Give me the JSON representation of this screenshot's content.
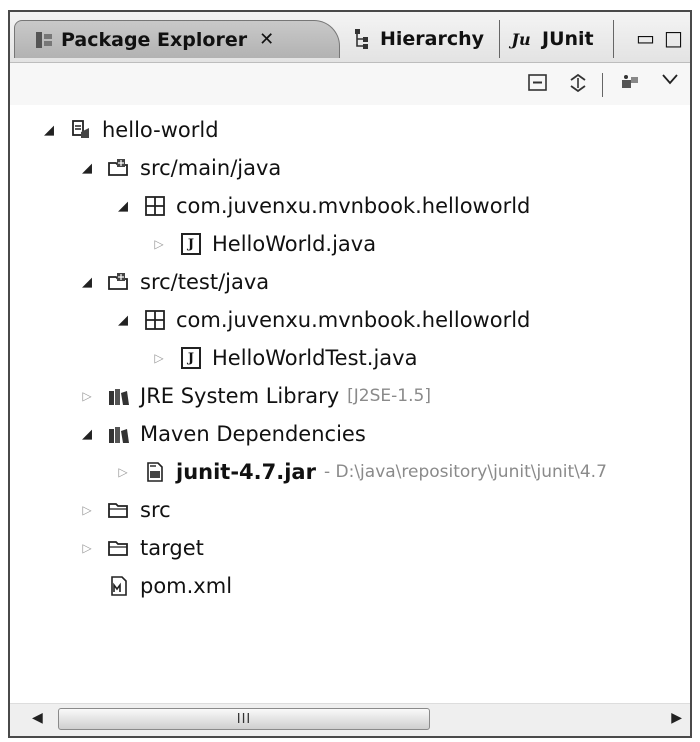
{
  "tabs": [
    {
      "label": "Package Explorer",
      "icon": "package-explorer-icon",
      "close": "✕",
      "active": true
    },
    {
      "label": "Hierarchy",
      "icon": "hierarchy-icon"
    },
    {
      "label": "JUnit",
      "icon": "junit-icon",
      "icon_text": "Ju"
    }
  ],
  "window_controls": {
    "minimize": "▭",
    "maximize": "□"
  },
  "toolbar": {
    "collapse_all_icon": "collapse-all-icon",
    "link_editor_icon": "link-with-editor-icon",
    "filter_icon": "filter-icon",
    "menu_icon": "view-menu-icon"
  },
  "tree": [
    {
      "label": "hello-world",
      "icon": "project-icon"
    },
    {
      "label": "src/main/java",
      "icon": "source-folder-icon"
    },
    {
      "label": "com.juvenxu.mvnbook.helloworld",
      "icon": "package-icon"
    },
    {
      "label": "HelloWorld.java",
      "icon": "java-file-icon"
    },
    {
      "label": "src/test/java",
      "icon": "source-folder-icon"
    },
    {
      "label": "com.juvenxu.mvnbook.helloworld",
      "icon": "package-icon"
    },
    {
      "label": "HelloWorldTest.java",
      "icon": "java-file-icon"
    },
    {
      "label": "JRE System Library",
      "suffix": "[J2SE-1.5]",
      "icon": "library-icon"
    },
    {
      "label": "Maven Dependencies",
      "icon": "library-icon"
    },
    {
      "label": "junit-4.7.jar",
      "suffix": "- D:\\java\\repository\\junit\\junit\\4.7",
      "icon": "jar-icon"
    },
    {
      "label": "src",
      "icon": "folder-icon"
    },
    {
      "label": "target",
      "icon": "folder-icon"
    },
    {
      "label": "pom.xml",
      "icon": "maven-pom-icon"
    }
  ],
  "scrollbar": {
    "grip": "III"
  }
}
